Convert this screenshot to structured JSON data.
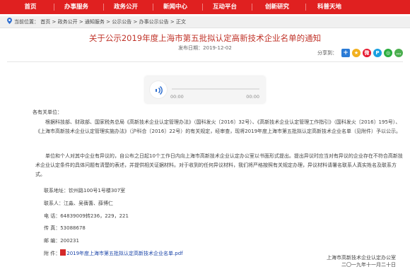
{
  "nav": {
    "items": [
      "首页",
      "办事服务",
      "政务公开",
      "新闻中心",
      "互动平台",
      "创新研究",
      "科普天地"
    ]
  },
  "breadcrumb": {
    "prefix": "当前位置：",
    "items": [
      "首页",
      "政务公开",
      "通知服务",
      "公示公告",
      "办事公示公告",
      "正文"
    ],
    "separator": ">"
  },
  "article": {
    "title": "关于公示2019年度上海市第五批拟认定高新技术企业名单的通知",
    "date_label": "发布日期：2019-12-02"
  },
  "share": {
    "label": "分享到：",
    "icons": [
      "plus-share",
      "qzone",
      "weibo",
      "pengyou",
      "wechat",
      "more"
    ]
  },
  "player": {
    "current_time": "00:00",
    "duration": "00:00"
  },
  "body": {
    "greeting": "各有关单位：",
    "para1": "根据科技部、财政部、国家税务总局《高新技术企业认定管理办法》（国科发火〔2016〕32号）、《高新技术企业认定管理工作指引》（国科发火〔2016〕195号）、《上海市高新技术企业认定管理实施办法》（沪科合〔2016〕22号）的有关规定，经审查，现将2019年度上海市第五批拟认定高新技术企业名单（见附件）予以公示。",
    "para2": "单位和个人对其中企业有异议的，自公布之日起10个工作日内向上海市高新技术企业认定办公室以书面形式提出。提出异议时应当对有异议的企业存在不符合高新技术企业认定条件的具体问题有清楚的表述，并提供相关证据材料。对于收到的任何异议材料，我们将严格按照有关规定办理，异议材料请署名联系人真实姓名及联系方式。",
    "address": "联系地址：钦州路100号1号楼307室",
    "contacts": "联系人：江淼、吴蒨蓍、薛博仁",
    "phone": "电    话：64839009转236，229，221",
    "fax": "传    真：53088678",
    "postcode": "邮    编：200231",
    "attach_label": "附    件：",
    "attach_file": "2019年度上海市第五批拟认定高新技术企业名单.pdf"
  },
  "signature": {
    "org": "上海市高新技术企业认定办公室",
    "date": "二〇一九年十一月二十日"
  },
  "colors": {
    "nav_bg": "#e02020",
    "title": "#c0342a",
    "player_accent": "#2f6fd0",
    "link": "#1a44a8"
  }
}
